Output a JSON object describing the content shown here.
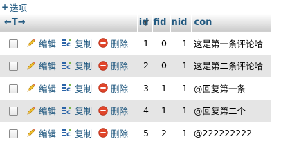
{
  "options": {
    "icon": "plus-icon",
    "label": "+",
    "text": "选项"
  },
  "header": {
    "sort_control": "←T→",
    "columns": [
      "id",
      "fid",
      "nid",
      "con"
    ]
  },
  "row_actions": {
    "edit": "编辑",
    "copy": "复制",
    "delete": "删除"
  },
  "rows": [
    {
      "id": "1",
      "fid": "0",
      "nid": "1",
      "con": "这是第一条评论哈"
    },
    {
      "id": "2",
      "fid": "0",
      "nid": "1",
      "con": "这是第二条评论哈"
    },
    {
      "id": "3",
      "fid": "1",
      "nid": "1",
      "con": "@回复第一条"
    },
    {
      "id": "4",
      "fid": "1",
      "nid": "1",
      "con": "@回复第二个"
    },
    {
      "id": "5",
      "fid": "2",
      "nid": "1",
      "con": "@222222222"
    }
  ],
  "colors": {
    "link": "#235a81",
    "row_even": "#e5e5e5",
    "delete_icon": "#e0452a"
  }
}
